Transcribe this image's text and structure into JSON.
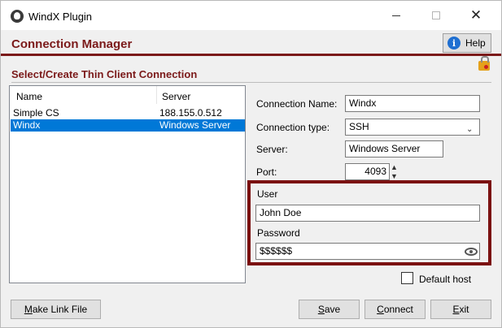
{
  "window": {
    "title": "WindX Plugin",
    "minimize_glyph": "",
    "close_glyph": "✕"
  },
  "header": {
    "title": "Connection Manager",
    "help_label": "Help",
    "help_icon": "info-icon"
  },
  "section": {
    "title": "Select/Create Thin Client Connection"
  },
  "connections": {
    "columns": [
      "Name",
      "Server"
    ],
    "rows": [
      {
        "name": "Simple CS",
        "server": "188.155.0.512"
      },
      {
        "name": "Windx",
        "server": "Windows Server",
        "selected": true
      }
    ]
  },
  "form": {
    "connection_name_label": "Connection Name:",
    "connection_name_value": "Windx",
    "connection_type_label": "Connection type:",
    "connection_type_value": "SSH",
    "server_label": "Server:",
    "server_value": "Windows Server",
    "port_label": "Port:",
    "port_value": "4093",
    "user_label": "User",
    "user_value": "John Doe",
    "password_label": "Password",
    "password_value": "$$$$$$",
    "default_host_label": "Default host",
    "default_host_checked": false
  },
  "buttons": {
    "make_link_mnemonic": "M",
    "make_link_rest": "ake Link File",
    "save_mnemonic": "S",
    "save_rest": "ave",
    "connect_mnemonic": "C",
    "connect_rest": "onnect",
    "exit_mnemonic": "E",
    "exit_rest": "xit"
  },
  "colors": {
    "accent": "#7b1a1a",
    "selection": "#0078d7",
    "highlight_border": "#7b1010"
  }
}
